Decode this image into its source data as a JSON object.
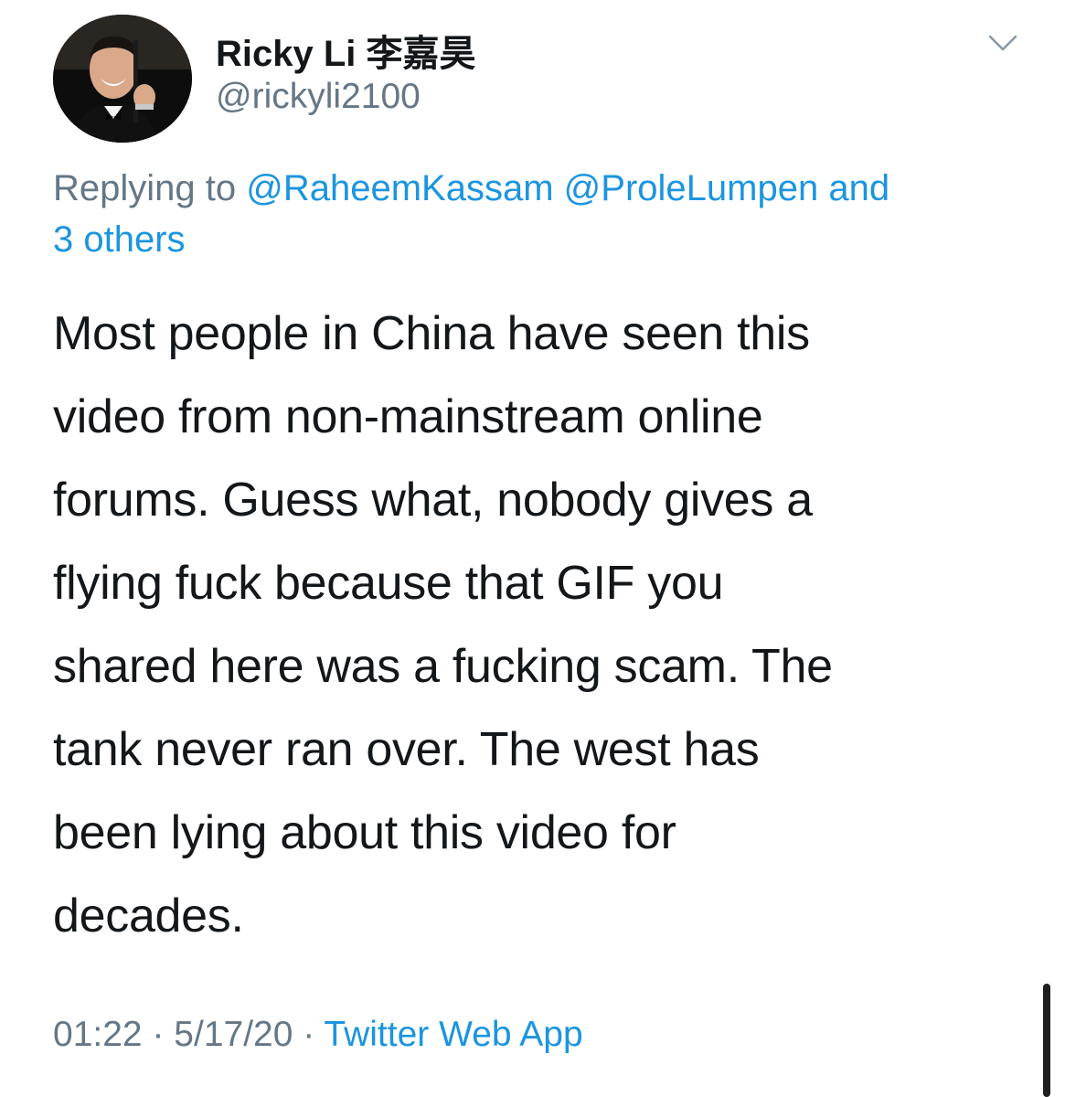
{
  "tweet": {
    "author": {
      "display_name": "Ricky Li 李嘉昊",
      "handle": "@rickyli2100",
      "avatar_icon": "profile-photo"
    },
    "menu_icon": "chevron-down-icon",
    "reply_context": {
      "prefix": "Replying to",
      "mentions": [
        "@RaheemKassam",
        "@ProleLumpen"
      ],
      "connector": "and",
      "others": "3 others"
    },
    "text_lines": [
      "Most people in China have seen this",
      "video from non-mainstream online",
      "forums. Guess what, nobody gives a",
      "flying fuck because that GIF you",
      "shared here was a fucking scam. The",
      "tank never ran over. The west has",
      "been lying about this video for",
      "decades."
    ],
    "meta": {
      "time": "01:22",
      "separator": "·",
      "date": "5/17/20",
      "source": "Twitter Web App"
    }
  },
  "colors": {
    "text": "#14171a",
    "secondary": "#657786",
    "link": "#1b95e0",
    "background": "#ffffff"
  }
}
